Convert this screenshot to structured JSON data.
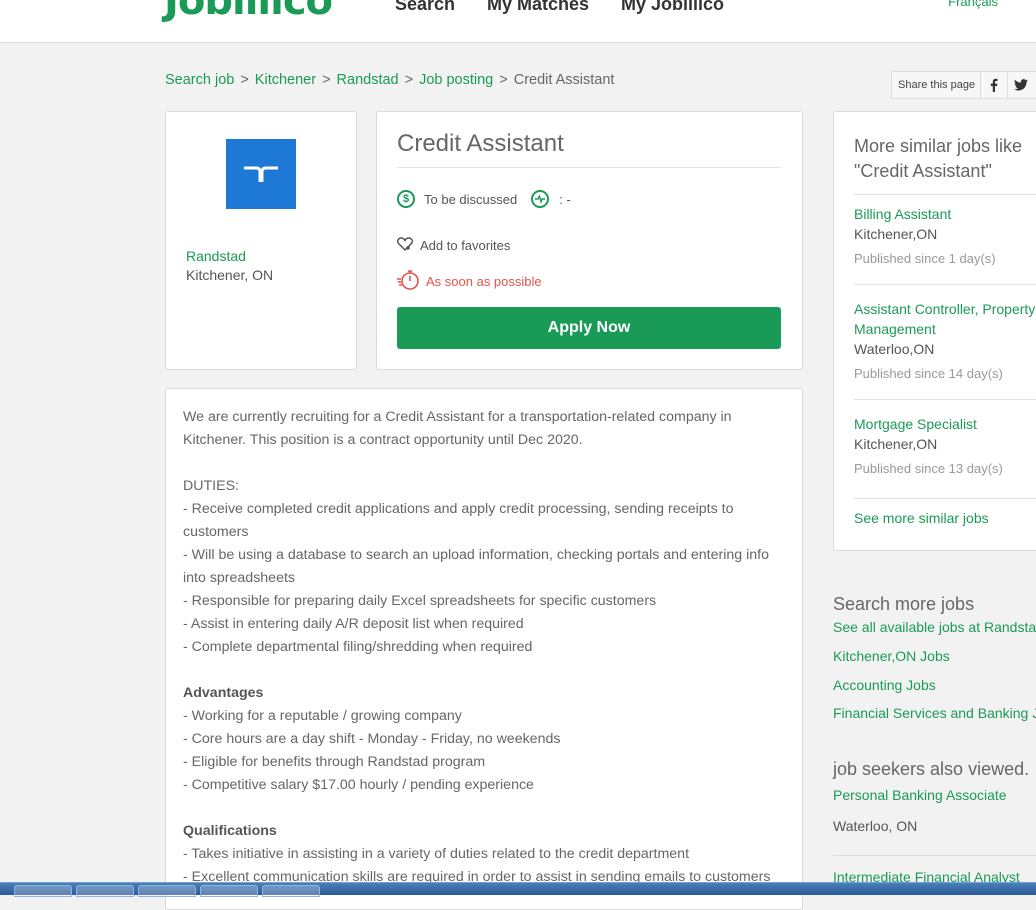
{
  "header": {
    "logo": "Jobillico",
    "nav": [
      "Search",
      "My Matches",
      "My Jobillico"
    ],
    "language": "Français"
  },
  "breadcrumb": [
    "Search job",
    "Kitchener",
    "Randstad",
    "Job posting",
    "Credit Assistant"
  ],
  "share": {
    "label": "Share this page"
  },
  "company": {
    "name": "Randstad",
    "location": "Kitchener, ON"
  },
  "job": {
    "title": "Credit Assistant",
    "salary": "To be discussed",
    "hours": ": -",
    "favorites": "Add to favorites",
    "start": "As soon as possible",
    "apply": "Apply Now"
  },
  "description": {
    "intro": "We are currently recruiting for a Credit Assistant for a transportation-related company in Kitchener. This position is a contract opportunity until Dec 2020.",
    "duties_title": "DUTIES:",
    "duties": [
      "- Receive completed credit applications and apply credit processing, sending receipts to customers",
      "- Will be using a database to search an upload information, checking portals and entering info into spreadsheets",
      "- Responsible for preparing daily Excel spreadsheets for specific customers",
      "- Assist in entering daily A/R deposit list when required",
      "- Complete departmental filing/shredding when required"
    ],
    "advantages_title": "Advantages",
    "advantages": [
      "- Working for a reputable / growing company",
      "- Core hours are a day shift - Monday - Friday, no weekends",
      "- Eligible for benefits through Randstad program",
      "- Competitive salary $17.00 hourly / pending experience"
    ],
    "qualifications_title": "Qualifications",
    "qualifications": [
      "- Takes initiative in assisting in a variety of duties related to the credit department",
      "- Excellent communication skills are required in order to assist in sending emails to customers"
    ]
  },
  "similar": {
    "title": "More similar jobs like \"Credit Assistant\"",
    "items": [
      {
        "title": "Billing Assistant",
        "location": "Kitchener,ON",
        "published": "Published since 1 day(s)"
      },
      {
        "title": "Assistant Controller, Property Management",
        "location": "Waterloo,ON",
        "published": "Published since 14 day(s)"
      },
      {
        "title": "Mortgage Specialist",
        "location": "Kitchener,ON",
        "published": "Published since 13 day(s)"
      }
    ],
    "see_more": "See more similar jobs"
  },
  "search_more": {
    "title": "Search more jobs",
    "links": [
      "See all available jobs at Randstad",
      "Kitchener,ON Jobs",
      "Accounting Jobs",
      "Financial Services and Banking Jobs"
    ]
  },
  "also_viewed": {
    "title": "job seekers also viewed.",
    "items": [
      {
        "title": "Personal Banking Associate",
        "location": "Waterloo, ON"
      },
      {
        "title": "Intermediate Financial Analyst"
      }
    ]
  }
}
